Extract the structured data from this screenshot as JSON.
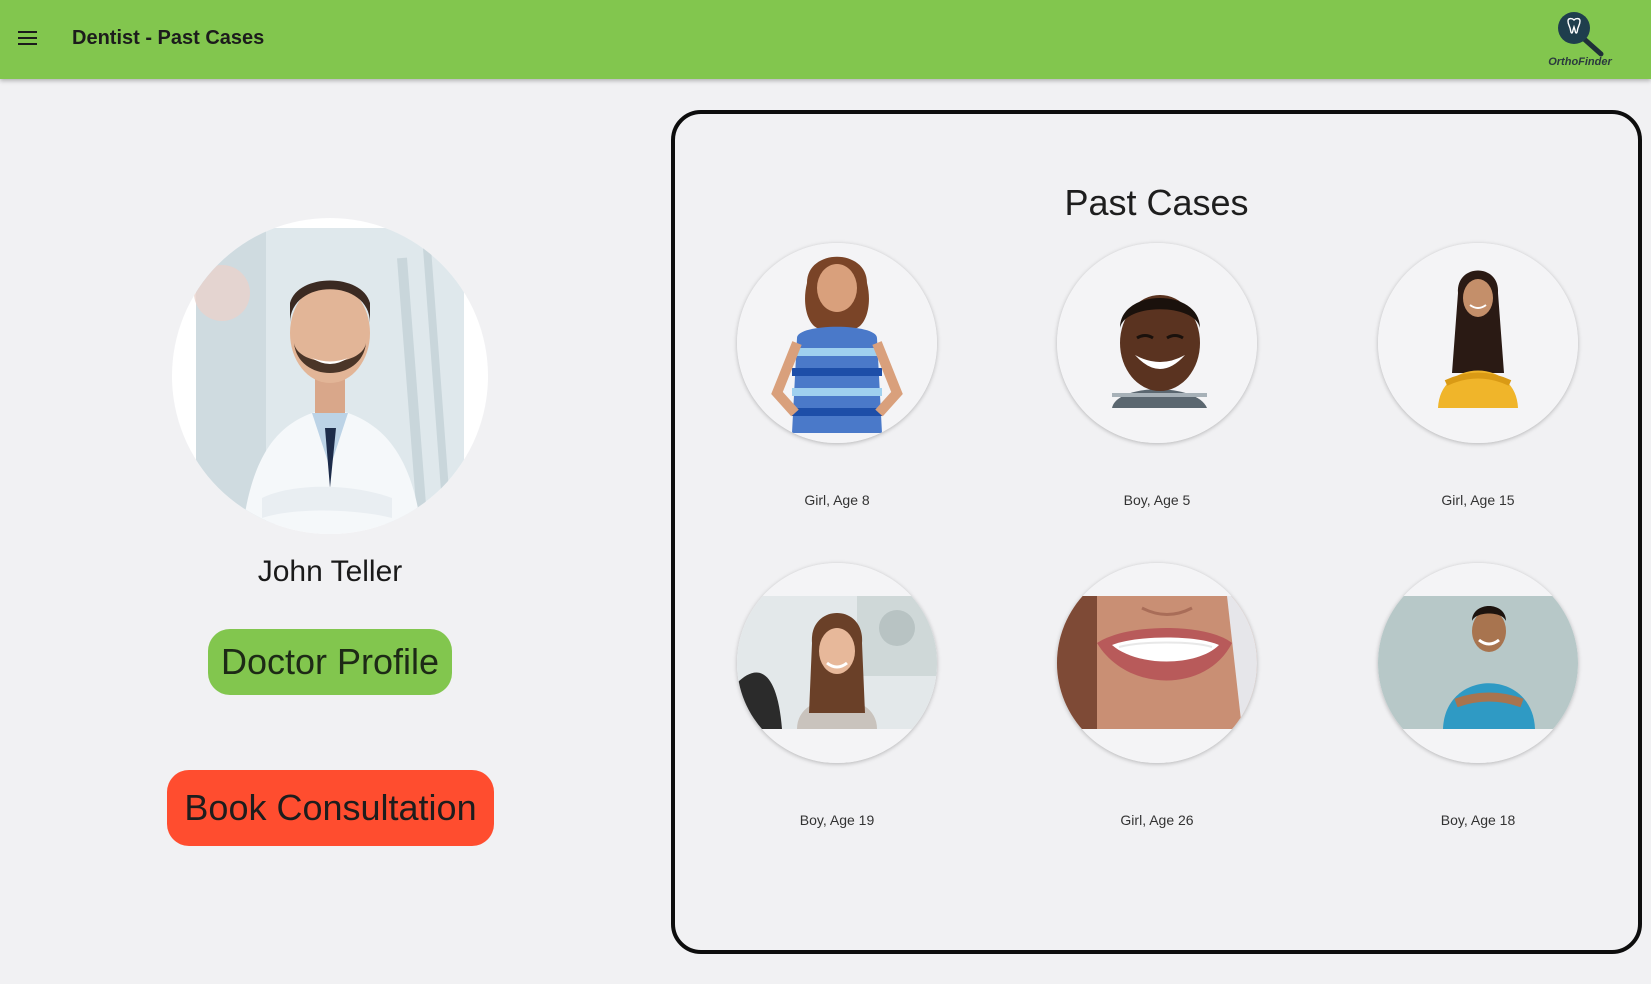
{
  "header": {
    "title": "Dentist - Past Cases",
    "logo_text": "OrthoFinder",
    "icons": {
      "menu": "hamburger-menu-icon",
      "logo": "tooth-magnifier-icon"
    }
  },
  "doctor": {
    "name": "John Teller",
    "photo": "dentist-portrait-photo",
    "profile_button": "Doctor Profile",
    "consult_button": "Book Consultation"
  },
  "cases": {
    "title": "Past Cases",
    "items": [
      {
        "label": "Girl, Age 8",
        "photo": "girl-striped-shirt-photo"
      },
      {
        "label": "Boy, Age 5",
        "photo": "smiling-boy-photo"
      },
      {
        "label": "Girl, Age 15",
        "photo": "girl-yellow-sweater-photo"
      },
      {
        "label": "Boy, Age 19",
        "photo": "woman-dental-chair-photo"
      },
      {
        "label": "Girl, Age 26",
        "photo": "smile-closeup-photo"
      },
      {
        "label": "Boy, Age 18",
        "photo": "man-blue-tshirt-photo"
      }
    ]
  },
  "colors": {
    "header": "#82c64e",
    "profile_button": "#82c64e",
    "consult_button": "#ff4d2f",
    "background": "#f1f1f3",
    "panel_border": "#0d0d0d"
  }
}
